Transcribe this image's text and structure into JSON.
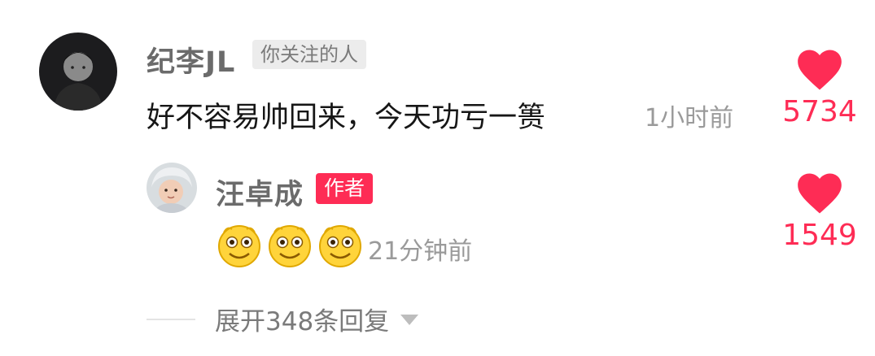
{
  "comment": {
    "username": "纪李JL",
    "follow_tag": "你关注的人",
    "text": "好不容易帅回来，今天功亏一篑",
    "time": "1小时前",
    "likes": "5734",
    "avatar_icon": "profile-photo-dark"
  },
  "reply": {
    "username": "汪卓成",
    "author_tag": "作者",
    "emojis": [
      "smile-emoji",
      "smile-emoji",
      "smile-emoji"
    ],
    "time": "21分钟前",
    "likes": "1549",
    "avatar_icon": "profile-photo-baby"
  },
  "expand": {
    "label": "展开348条回复"
  },
  "colors": {
    "accent": "#fe2c55",
    "name": "#6b6b6b",
    "muted": "#9a9a9a",
    "text": "#161616"
  }
}
